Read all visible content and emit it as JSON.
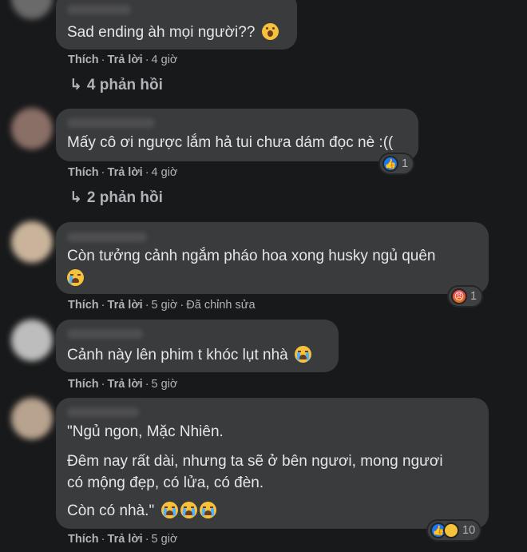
{
  "comments": [
    {
      "lines": [
        "Sad ending àh mọi người??"
      ],
      "emoji": "wow",
      "actions": {
        "like": "Thích",
        "reply": "Trả lời",
        "time": "4 giờ"
      },
      "replies": "4 phản hồi"
    },
    {
      "lines": [
        "Mấy cô ơi ngược lắm hả tui chưa dám đọc nè :(("
      ],
      "actions": {
        "like": "Thích",
        "reply": "Trả lời",
        "time": "4 giờ"
      },
      "reaction": {
        "icons": [
          "like-icon"
        ],
        "count": "1"
      },
      "replies": "2 phản hồi"
    },
    {
      "lines": [
        "Còn tưởng cảnh ngắm pháo hoa xong husky ngủ quên"
      ],
      "emoji": "cry",
      "actions": {
        "like": "Thích",
        "reply": "Trả lời",
        "time": "5 giờ",
        "edited": "Đã chỉnh sửa"
      },
      "reaction": {
        "icons": [
          "angry-icon"
        ],
        "count": "1"
      }
    },
    {
      "lines": [
        "Cảnh này lên phim t khóc lụt nhà"
      ],
      "emoji": "cry",
      "actions": {
        "like": "Thích",
        "reply": "Trả lời",
        "time": "5 giờ"
      }
    },
    {
      "lines": [
        "\"Ngủ ngon, Mặc Nhiên.",
        "Đêm nay rất dài, nhưng ta sẽ ở bên ngươi, mong ngươi",
        "có mộng đẹp, có lửa, có đèn.",
        "Còn có nhà.\""
      ],
      "actions": {
        "like": "Thích",
        "reply": "Trả lời",
        "time": "5 giờ"
      },
      "reaction": {
        "icons": [
          "like-icon",
          "sad-icon"
        ],
        "count": "10"
      }
    }
  ],
  "colors": {
    "background": "#18191a",
    "bubble": "#3a3b3c",
    "text": "#e4e6eb",
    "muted": "#b0b3b8",
    "like": "#1877f2"
  }
}
